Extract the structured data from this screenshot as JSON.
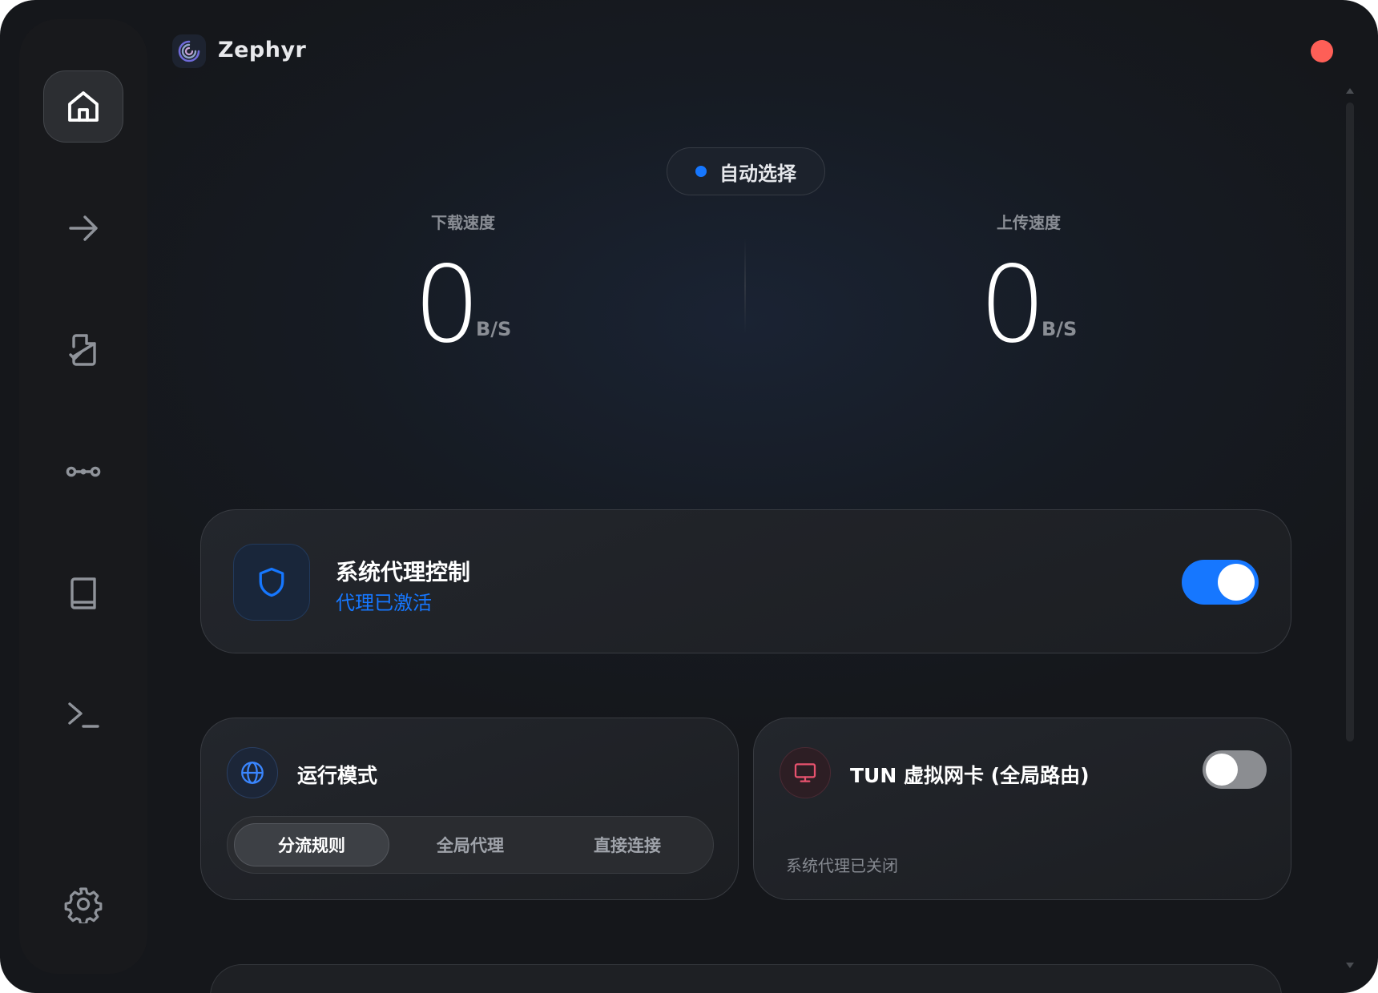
{
  "app": {
    "title": "Zephyr"
  },
  "sidebar": {
    "items": [
      {
        "id": "home",
        "icon": "home-icon",
        "active": true
      },
      {
        "id": "proxies",
        "icon": "arrow-right-icon",
        "active": false
      },
      {
        "id": "profiles",
        "icon": "file-check-icon",
        "active": false
      },
      {
        "id": "connections",
        "icon": "connection-icon",
        "active": false
      },
      {
        "id": "rules",
        "icon": "book-icon",
        "active": false
      },
      {
        "id": "logs",
        "icon": "terminal-icon",
        "active": false
      },
      {
        "id": "settings",
        "icon": "gear-icon",
        "active": false
      }
    ]
  },
  "node": {
    "label": "自动选择",
    "dot_color": "#1677ff"
  },
  "speed": {
    "download": {
      "label": "下载速度",
      "value": "0",
      "unit": "B/S"
    },
    "upload": {
      "label": "上传速度",
      "value": "0",
      "unit": "B/S"
    }
  },
  "proxy_control": {
    "title": "系统代理控制",
    "status": "代理已激活",
    "enabled": true,
    "icon": "shield-icon"
  },
  "run_mode": {
    "title": "运行模式",
    "icon": "globe-icon",
    "options": [
      "分流规则",
      "全局代理",
      "直接连接"
    ],
    "selected": "分流规则"
  },
  "tun": {
    "title": "TUN 虚拟网卡 (全局路由)",
    "icon": "monitor-icon",
    "enabled": false,
    "status": "系统代理已关闭"
  },
  "colors": {
    "accent": "#1677ff",
    "close": "#fe5f57",
    "tun_icon": "#e8526e"
  }
}
